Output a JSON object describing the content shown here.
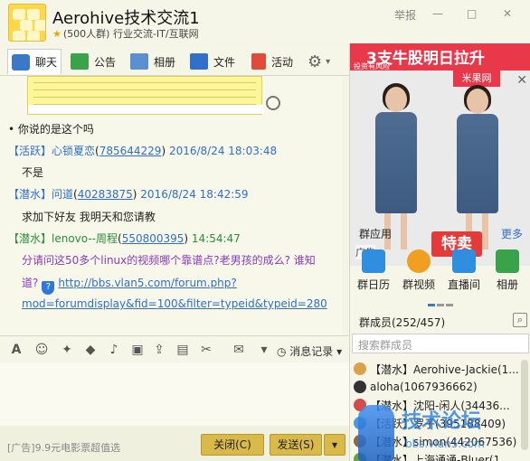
{
  "header": {
    "title": "Aerohive技术交流1",
    "subtitle": "(500人群) 行业交流-IT/互联网",
    "report": "举报",
    "min_glyph": "—",
    "max_glyph": "□",
    "close_glyph": "✕"
  },
  "tabs": [
    {
      "label": "聊天",
      "icon": "chat-icon",
      "color": "#3a78c8"
    },
    {
      "label": "公告",
      "icon": "flag-icon",
      "color": "#3aa34a"
    },
    {
      "label": "相册",
      "icon": "photo-icon",
      "color": "#5a8fd0"
    },
    {
      "label": "文件",
      "icon": "folder-icon",
      "color": "#2f70c8"
    },
    {
      "label": "活动",
      "icon": "pin-flag-icon",
      "color": "#e04a3a"
    }
  ],
  "chat": {
    "line0": "• 你说的是这个吗",
    "m1": {
      "tag": "【活跃】",
      "name": "心锁夏恋",
      "uid": "785644229",
      "time": "2016/8/24 18:03:48",
      "body": "不是"
    },
    "m2": {
      "tag": "【潜水】",
      "name": "问道",
      "uid": "40283875",
      "time": "2016/8/24 18:42:59",
      "body": "求加下好友 我明天和您请教"
    },
    "m3": {
      "tag": "【潜水】",
      "name": "lenovo--周程",
      "uid": "550800395",
      "time": "14:54:47",
      "body1": "分请问这50多个linux的视频哪个靠谱点?老男孩的成么? 谁知",
      "body2_prefix": "道?",
      "link1": "http://bbs.vlan5.com/forum.php?",
      "link2": "mod=forumdisplay&fid=100&filter=typeid&typeid=280"
    }
  },
  "input_toolbar": {
    "history": "消息记录"
  },
  "footer": {
    "ad": "[广告]9.9元电影票超值选",
    "close_label": "关闭(C)",
    "send_label": "发送(S)"
  },
  "right": {
    "ad_top": "3支牛股明日拉升",
    "ad_top_small": "投资有风险",
    "brand": "米果网",
    "sale": "特卖",
    "ad_label": "广告",
    "apps_title": "群应用",
    "more": "更多",
    "apps": [
      {
        "label": "群日历",
        "icon": "calendar-icon",
        "color": "#2f8ee0"
      },
      {
        "label": "群视频",
        "icon": "video-icon",
        "color": "#f0a020"
      },
      {
        "label": "直播间",
        "icon": "live-icon",
        "color": "#2f8ee0"
      },
      {
        "label": "相册",
        "icon": "album-icon",
        "color": "#3aa34a"
      }
    ],
    "members_title": "群成员(252/457)",
    "search_placeholder": "搜索群成员",
    "members": [
      "【潜水】Aerohive-Jackie(1...",
      "aloha(1067936662)",
      "【潜水】沈阳-闲人(34436...",
      "【活跃】罗子(395188409)",
      "【潜水】simon(442067536)",
      "【潜水】上海通通-Bluer(1..."
    ],
    "watermark": "技术论坛",
    "watermark_url": "bbs.vlan5.com"
  }
}
